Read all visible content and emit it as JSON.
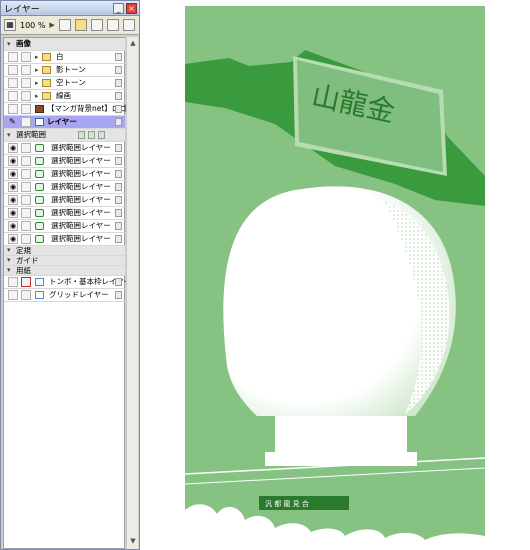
{
  "window": {
    "title": "レイヤー",
    "minimize_label": "_",
    "close_label": "×"
  },
  "toolbar": {
    "zoom": "100 %",
    "zoom_arrow": "▶"
  },
  "layers": {
    "group_gazo": "画像",
    "shiro": "白",
    "kage_tone": "影トーン",
    "sora_tone": "空トーン",
    "sen_ga": "線画",
    "manga_logo": "【マンガ背景net】ロゴ",
    "layer": "レイヤー",
    "group_sentaku": "選択範囲",
    "sel_layers": [
      "選択範囲レイヤー",
      "選択範囲レイヤー",
      "選択範囲レイヤー",
      "選択範囲レイヤー",
      "選択範囲レイヤー",
      "選択範囲レイヤー",
      "選択範囲レイヤー",
      "選択範囲レイヤー"
    ],
    "group_jogi": "定規",
    "group_guide": "ガイド",
    "group_yoshi": "用紙",
    "tonbo": "トンボ・基本枠レイヤー",
    "grid": "グリッドレイヤー"
  },
  "canvas": {
    "sign_text": "山龍金",
    "small_sign_text": "汎 都 龍 見 合",
    "colors": {
      "bg": "#86c282",
      "dark_green": "#3a9a3e",
      "white": "#ffffff"
    }
  }
}
